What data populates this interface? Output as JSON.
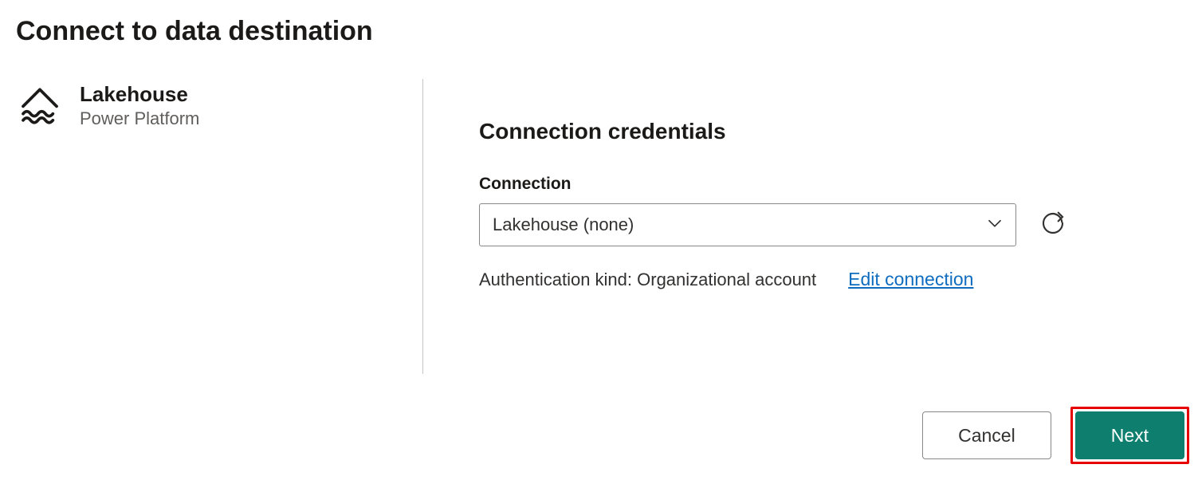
{
  "header": {
    "title": "Connect to data destination"
  },
  "dataSource": {
    "title": "Lakehouse",
    "subtitle": "Power Platform"
  },
  "credentials": {
    "sectionTitle": "Connection credentials",
    "fieldLabel": "Connection",
    "selectedValue": "Lakehouse (none)",
    "authLine": "Authentication kind: Organizational account",
    "editLink": "Edit connection"
  },
  "buttons": {
    "cancel": "Cancel",
    "next": "Next"
  }
}
